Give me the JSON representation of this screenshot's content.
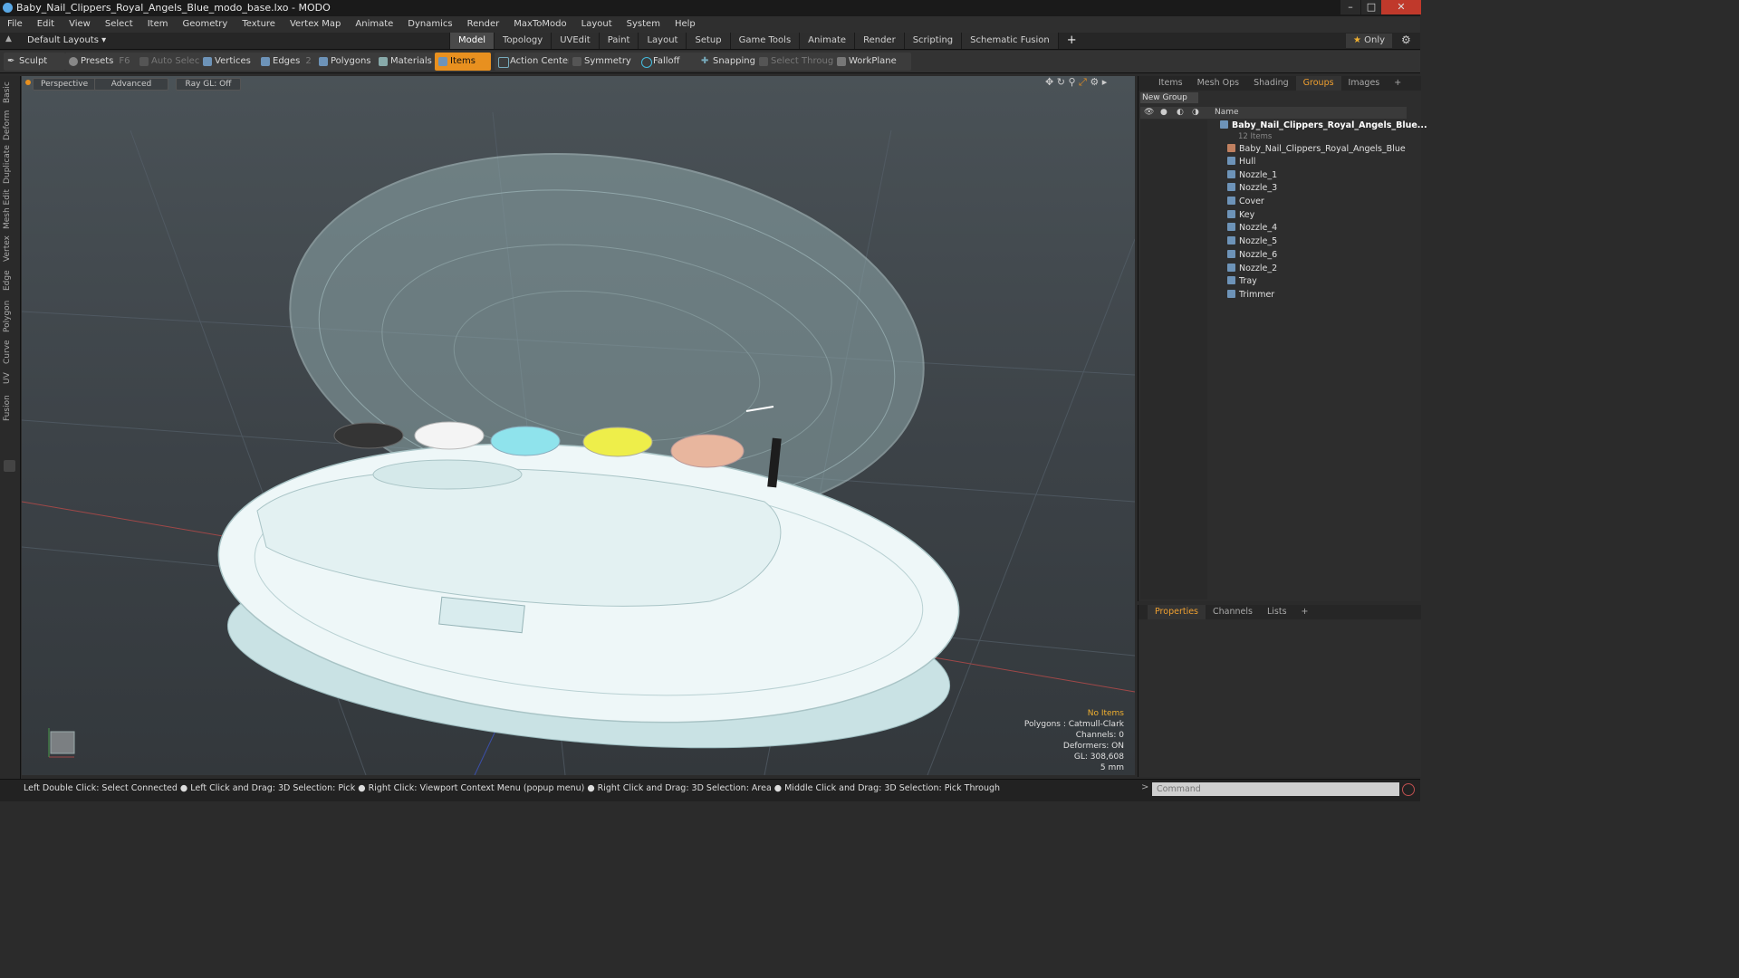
{
  "window": {
    "title": "Baby_Nail_Clippers_Royal_Angels_Blue_modo_base.lxo - MODO",
    "controls": [
      "minimize-icon",
      "maximize-icon",
      "close-icon"
    ]
  },
  "menubar": [
    "File",
    "Edit",
    "View",
    "Select",
    "Item",
    "Geometry",
    "Texture",
    "Vertex Map",
    "Animate",
    "Dynamics",
    "Render",
    "MaxToModo",
    "Layout",
    "System",
    "Help"
  ],
  "layoutbar": {
    "layouts_label": "Default Layouts",
    "tabs": [
      "Model",
      "Topology",
      "UVEdit",
      "Paint",
      "Layout",
      "Setup",
      "Game Tools",
      "Animate",
      "Render",
      "Scripting",
      "Schematic Fusion"
    ],
    "active_tab": "Model",
    "only_label": "Only"
  },
  "toolbar": {
    "sculpt": "Sculpt",
    "presets": "Presets",
    "presets_key": "F6",
    "auto_select": "Auto Select",
    "vertices": "Vertices",
    "vertices_count": "1",
    "edges": "Edges",
    "edges_count": "2",
    "polygons": "Polygons",
    "materials": "Materials",
    "items": "Items",
    "action_center": "Action Center",
    "symmetry": "Symmetry",
    "falloff": "Falloff",
    "snapping": "Snapping",
    "select_through": "Select Through",
    "workplane": "WorkPlane"
  },
  "left_tabs": [
    "Basic",
    "Deform",
    "Duplicate",
    "Mesh Edit",
    "Vertex",
    "Edge",
    "Polygon",
    "Curve",
    "UV",
    "Fusion"
  ],
  "viewport": {
    "view_mode": "Perspective",
    "shading": "Advanced",
    "raygl": "Ray GL: Off",
    "info": {
      "selection": "No Items",
      "polygons": "Polygons : Catmull-Clark",
      "channels": "Channels: 0",
      "deformers": "Deformers: ON",
      "gl": "GL: 308,608",
      "scale": "5 mm"
    }
  },
  "right_panel": {
    "tabs": [
      "Items",
      "Mesh Ops",
      "Shading",
      "Groups",
      "Images"
    ],
    "active_tab": "Groups",
    "new_group": "New Group",
    "column_name": "Name",
    "root": {
      "name": "Baby_Nail_Clippers_Royal_Angels_Blue...",
      "count": "12 Items"
    },
    "items": [
      "Baby_Nail_Clippers_Royal_Angels_Blue",
      "Hull",
      "Nozzle_1",
      "Nozzle_3",
      "Cover",
      "Key",
      "Nozzle_4",
      "Nozzle_5",
      "Nozzle_6",
      "Nozzle_2",
      "Tray",
      "Trimmer"
    ]
  },
  "properties_panel": {
    "tabs": [
      "Properties",
      "Channels",
      "Lists"
    ],
    "active_tab": "Properties"
  },
  "statusbar": {
    "hint": "Left Double Click: Select Connected ● Left Click and Drag: 3D Selection: Pick ● Right Click: Viewport Context Menu (popup menu) ● Right Click and Drag: 3D Selection: Area ● Middle Click and Drag: 3D Selection: Pick Through"
  },
  "command": {
    "placeholder": "Command"
  },
  "colors": {
    "accent": "#e8901f",
    "active_tab_text": "#f0a030",
    "model_body": "#e8f3f4",
    "model_cover": "#a9c2c4"
  }
}
